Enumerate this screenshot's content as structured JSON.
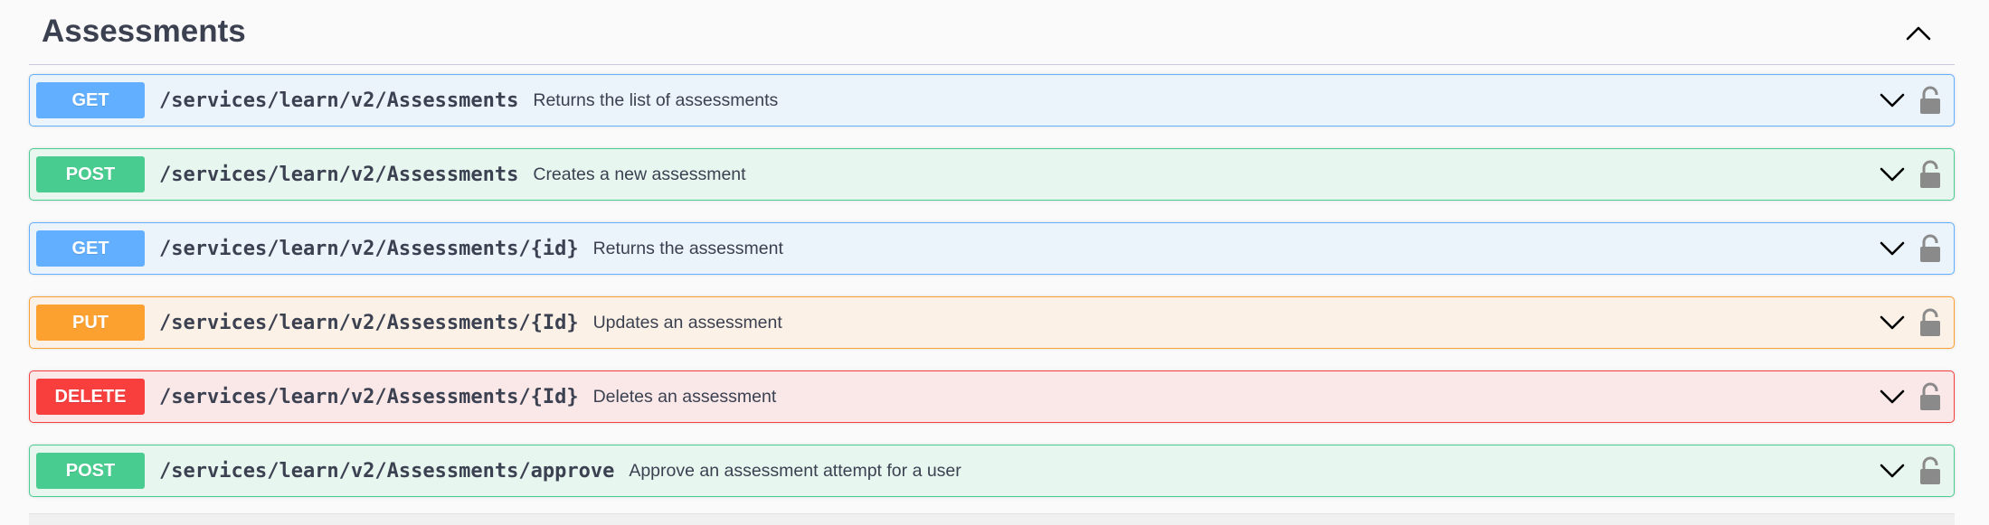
{
  "section": {
    "title": "Assessments"
  },
  "operations": [
    {
      "method": "GET",
      "path": "/services/learn/v2/Assessments",
      "summary": "Returns the list of assessments"
    },
    {
      "method": "POST",
      "path": "/services/learn/v2/Assessments",
      "summary": "Creates a new assessment"
    },
    {
      "method": "GET",
      "path": "/services/learn/v2/Assessments/{id}",
      "summary": "Returns the assessment"
    },
    {
      "method": "PUT",
      "path": "/services/learn/v2/Assessments/{Id}",
      "summary": "Updates an assessment"
    },
    {
      "method": "DELETE",
      "path": "/services/learn/v2/Assessments/{Id}",
      "summary": "Deletes an assessment"
    },
    {
      "method": "POST",
      "path": "/services/learn/v2/Assessments/approve",
      "summary": "Approve an assessment attempt for a user"
    }
  ],
  "icons": {
    "collapse": "chevron-up-icon",
    "expand": "chevron-down-icon",
    "auth": "unlocked-lock-icon"
  },
  "colors": {
    "get": "#61affe",
    "post": "#49cc90",
    "put": "#fca130",
    "delete": "#f93e3e"
  }
}
